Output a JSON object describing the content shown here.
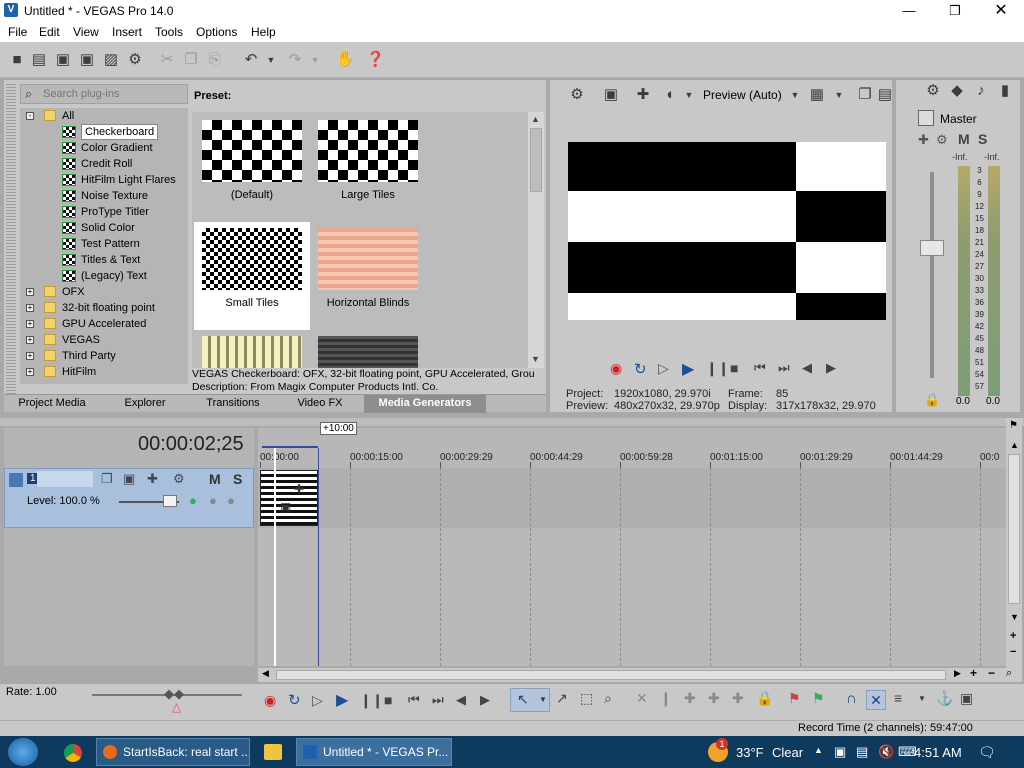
{
  "window": {
    "title": "Untitled * - VEGAS Pro 14.0"
  },
  "menu": [
    "File",
    "Edit",
    "View",
    "Insert",
    "Tools",
    "Options",
    "Help"
  ],
  "explorer": {
    "search_placeholder": "Search plug-ins",
    "tree": [
      {
        "label": "All",
        "kind": "folder",
        "expand": "-"
      },
      {
        "label": "Checkerboard",
        "kind": "plugin",
        "selected": true
      },
      {
        "label": "Color Gradient",
        "kind": "plugin"
      },
      {
        "label": "Credit Roll",
        "kind": "plugin"
      },
      {
        "label": "HitFilm Light Flares",
        "kind": "plugin"
      },
      {
        "label": "Noise Texture",
        "kind": "plugin"
      },
      {
        "label": "ProType Titler",
        "kind": "plugin"
      },
      {
        "label": "Solid Color",
        "kind": "plugin"
      },
      {
        "label": "Test Pattern",
        "kind": "plugin"
      },
      {
        "label": "Titles & Text",
        "kind": "plugin"
      },
      {
        "label": "(Legacy) Text",
        "kind": "plugin"
      },
      {
        "label": "OFX",
        "kind": "folder",
        "expand": "+"
      },
      {
        "label": "32-bit floating point",
        "kind": "folder",
        "expand": "+"
      },
      {
        "label": "GPU Accelerated",
        "kind": "folder",
        "expand": "+"
      },
      {
        "label": "VEGAS",
        "kind": "folder",
        "expand": "+"
      },
      {
        "label": "Third Party",
        "kind": "folder",
        "expand": "+"
      },
      {
        "label": "HitFilm",
        "kind": "folder",
        "expand": "+"
      }
    ],
    "preset_label": "Preset:",
    "presets": [
      {
        "label": "(Default)",
        "pattern": "checker-large"
      },
      {
        "label": "Large Tiles",
        "pattern": "checker-large"
      },
      {
        "label": "Small Tiles",
        "pattern": "checker-small",
        "selected": true
      },
      {
        "label": "Horizontal Blinds",
        "pattern": "blinds"
      },
      {
        "label": "",
        "pattern": "vertical-stripes"
      },
      {
        "label": "",
        "pattern": "dark-stripes"
      }
    ],
    "description_line1": "VEGAS Checkerboard: OFX, 32-bit floating point, GPU Accelerated, Grou",
    "description_line2": "Description: From Magix Computer Products Intl. Co.",
    "tabs": [
      "Project Media",
      "Explorer",
      "Transitions",
      "Video FX",
      "Media Generators"
    ],
    "active_tab": "Media Generators"
  },
  "preview": {
    "mode": "Preview (Auto)",
    "project_label": "Project:",
    "project_value": "1920x1080, 29.970i",
    "frame_label": "Frame:",
    "frame_value": "85",
    "preview_label": "Preview:",
    "preview_value": "480x270x32, 29.970p",
    "display_label": "Display:",
    "display_value": "317x178x32, 29.970"
  },
  "master": {
    "label": "Master",
    "mute": "M",
    "solo": "S",
    "peak_left": "-Inf.",
    "peak_right": "-Inf.",
    "scale": [
      "3",
      "6",
      "9",
      "12",
      "15",
      "18",
      "21",
      "24",
      "27",
      "30",
      "33",
      "36",
      "39",
      "42",
      "45",
      "48",
      "51",
      "54",
      "57"
    ],
    "level_left": "0.0",
    "level_right": "0.0"
  },
  "timeline": {
    "timecode": "00:00:02;25",
    "offset": "+10:00",
    "track_number": "1",
    "track_mute": "M",
    "track_solo": "S",
    "level": "Level: 100.0 %",
    "ruler": [
      "00:00:00",
      "00:00:15:00",
      "00:00:29:29",
      "00:00:44:29",
      "00:00:59:28",
      "00:01:15:00",
      "00:01:29:29",
      "00:01:44:29",
      "00:0"
    ]
  },
  "bottom": {
    "rate": "Rate: 1.00",
    "record_time": "Record Time (2 channels): 59:47:00"
  },
  "taskbar": {
    "tasks": [
      "StartIsBack: real start ...",
      "Untitled * - VEGAS Pr..."
    ],
    "weather_temp": "33°F",
    "weather_text": "Clear",
    "time": "4:51 AM",
    "notification_badge": "1"
  }
}
